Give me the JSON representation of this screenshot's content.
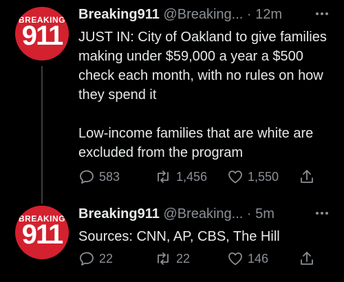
{
  "colors": {
    "background": "#000000",
    "avatar": "#d3212f",
    "secondary_text": "#8b9096",
    "primary_text": "#e7e9ea"
  },
  "tweets": [
    {
      "avatar": {
        "word": "BREAKING",
        "number": "911"
      },
      "name": "Breaking911",
      "handle": "@Breaking...",
      "dot": "·",
      "time": "12m",
      "more_icon": "more-dots-icon",
      "paragraphs": [
        "JUST IN: City of Oakland to give families making under $59,000 a year a $500 check each month, with no rules on how they spend it",
        "Low-income families that are white are excluded from the program"
      ],
      "counts": {
        "replies": "583",
        "retweets": "1,456",
        "likes": "1,550"
      }
    },
    {
      "avatar": {
        "word": "BREAKING",
        "number": "911"
      },
      "name": "Breaking911",
      "handle": "@Breaking...",
      "dot": "·",
      "time": "5m",
      "more_icon": "more-dots-icon",
      "paragraphs": [
        "Sources: CNN, AP, CBS, The Hill"
      ],
      "counts": {
        "replies": "22",
        "retweets": "22",
        "likes": "146"
      }
    }
  ]
}
